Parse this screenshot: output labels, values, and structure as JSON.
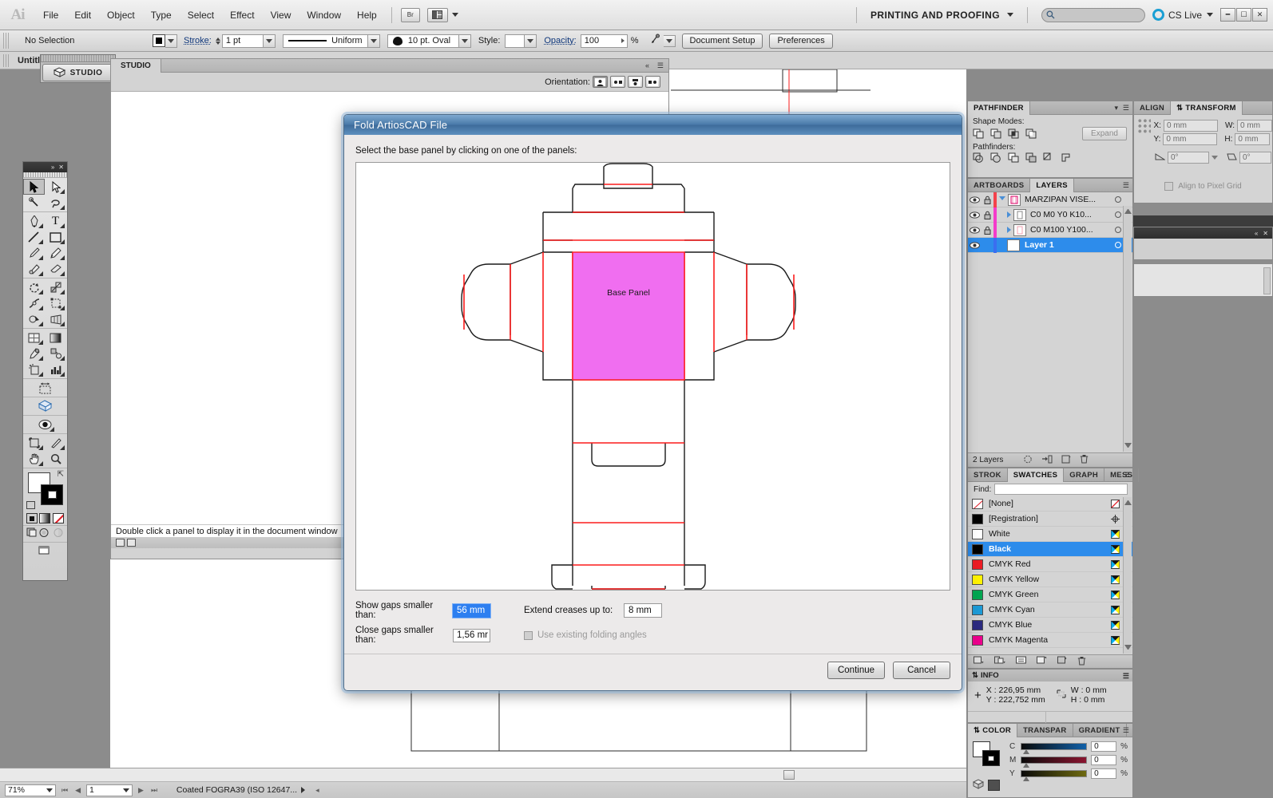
{
  "app": {
    "logo": "Ai",
    "menus": [
      "File",
      "Edit",
      "Object",
      "Type",
      "Select",
      "Effect",
      "View",
      "Window",
      "Help"
    ],
    "bridge_label": "Br",
    "workspace": "PRINTING AND PROOFING",
    "search_placeholder": "",
    "cslive": "CS Live"
  },
  "control_bar": {
    "selection_status": "No Selection",
    "stroke_label": "Stroke:",
    "stroke_weight": "1 pt",
    "profile": "Uniform",
    "brush": "10 pt. Oval",
    "style_label": "Style:",
    "opacity_label": "Opacity:",
    "opacity_value": "100",
    "opacity_unit": "%",
    "document_setup": "Document Setup",
    "preferences": "Preferences"
  },
  "document": {
    "tab_title": "Untitled"
  },
  "studio": {
    "float_button": "STUDIO",
    "tab": "STUDIO",
    "orientation_label": "Orientation:",
    "hint": "Double click a panel to display it in the document window"
  },
  "dialog": {
    "title": "Fold ArtiosCAD File",
    "instruction": "Select the base panel by clicking on one of the panels:",
    "base_panel_label": "Base Panel",
    "fields": {
      "show_gaps_label": "Show gaps smaller than:",
      "show_gaps_value": "56 mm",
      "close_gaps_label": "Close gaps smaller than:",
      "close_gaps_value": "1,56 mr",
      "extend_creases_label": "Extend creases up to:",
      "extend_creases_value": "8 mm",
      "use_existing_label": "Use existing folding angles",
      "use_existing_checked": false
    },
    "buttons": {
      "continue": "Continue",
      "cancel": "Cancel"
    },
    "colors": {
      "base_panel_fill": "#f06ef0",
      "crease_line": "#fc1c1c",
      "cut_line": "#1a1a1a"
    }
  },
  "pathfinder": {
    "tab": "PATHFINDER",
    "shape_modes_label": "Shape Modes:",
    "pathfinders_label": "Pathfinders:",
    "expand_button": "Expand"
  },
  "align_transform": {
    "align_tab": "ALIGN",
    "transform_tab": "TRANSFORM",
    "x_label": "X:",
    "x_value": "0 mm",
    "y_label": "Y:",
    "y_value": "0 mm",
    "w_label": "W:",
    "w_value": "0 mm",
    "h_label": "H:",
    "h_value": "0 mm",
    "angle_value": "0°",
    "shear_value": "0°",
    "align_pixel_grid": "Align to Pixel Grid"
  },
  "layers_panel": {
    "artboards_tab": "ARTBOARDS",
    "layers_tab": "LAYERS",
    "count_label": "2 Layers",
    "rows": [
      {
        "name": "MARZIPAN VISE...",
        "color": "#f4424b",
        "locked": true,
        "indent": 0,
        "selected": false,
        "expanded": true,
        "has_children": true
      },
      {
        "name": "C0 M0 Y0 K10...",
        "color": "#f43ccb",
        "locked": true,
        "indent": 1,
        "selected": false,
        "expanded": false,
        "has_children": true
      },
      {
        "name": "C0 M100 Y100...",
        "color": "#f43ccb",
        "locked": true,
        "indent": 1,
        "selected": false,
        "expanded": false,
        "has_children": true
      },
      {
        "name": "Layer 1",
        "color": "#3a6ef0",
        "locked": false,
        "indent": 0,
        "selected": true,
        "expanded": false,
        "has_children": false
      }
    ]
  },
  "swatches_panel": {
    "tabs": [
      "STROK",
      "SWATCHES",
      "GRAPH",
      "MESS"
    ],
    "active_tab": "SWATCHES",
    "find_label": "Find:",
    "find_value": "",
    "swatches": [
      {
        "name": "[None]",
        "color": "none",
        "mark": "none",
        "selected": false
      },
      {
        "name": "[Registration]",
        "color": "#000000",
        "mark": "registration",
        "selected": false
      },
      {
        "name": "White",
        "color": "#ffffff",
        "mark": "cmyk",
        "selected": false
      },
      {
        "name": "Black",
        "color": "#000000",
        "mark": "cmyk",
        "selected": true
      },
      {
        "name": "CMYK Red",
        "color": "#ec1c24",
        "mark": "cmyk",
        "selected": false
      },
      {
        "name": "CMYK Yellow",
        "color": "#fff200",
        "mark": "cmyk",
        "selected": false
      },
      {
        "name": "CMYK Green",
        "color": "#00a651",
        "mark": "cmyk",
        "selected": false
      },
      {
        "name": "CMYK Cyan",
        "color": "#1c9ad6",
        "mark": "cmyk",
        "selected": false
      },
      {
        "name": "CMYK Blue",
        "color": "#2b2a7f",
        "mark": "cmyk",
        "selected": false
      },
      {
        "name": "CMYK Magenta",
        "color": "#ec008c",
        "mark": "cmyk",
        "selected": false
      }
    ]
  },
  "info_panel": {
    "tab": "INFO",
    "x_label": "X",
    "x_value": ": 226,95 mm",
    "y_label": "Y",
    "y_value": ": 222,752 mm",
    "w_label": "W",
    "w_value": ": 0 mm",
    "h_label": "H",
    "h_value": ": 0 mm"
  },
  "color_panel": {
    "tabs": [
      "COLOR",
      "TRANSPAR",
      "GRADIENT"
    ],
    "active_tab": "COLOR",
    "channels": [
      {
        "label": "C",
        "value": "0",
        "unit": "%"
      },
      {
        "label": "M",
        "value": "0",
        "unit": "%"
      },
      {
        "label": "Y",
        "value": "0",
        "unit": "%"
      }
    ]
  },
  "status_bar": {
    "zoom": "71%",
    "page": "1",
    "profile": "Coated FOGRA39 (ISO 12647..."
  },
  "toolbox": {
    "tools": [
      [
        "selection-tool",
        "direct-selection-tool"
      ],
      [
        "magic-wand-tool",
        "lasso-tool"
      ],
      [
        "pen-tool",
        "type-tool"
      ],
      [
        "line-segment-tool",
        "rectangle-tool"
      ],
      [
        "paintbrush-tool",
        "pencil-tool"
      ],
      [
        "blob-brush-tool",
        "eraser-tool"
      ],
      [
        "rotate-tool",
        "scale-tool"
      ],
      [
        "width-tool",
        "free-transform-tool"
      ],
      [
        "shape-builder-tool",
        "perspective-grid-tool"
      ],
      [
        "mesh-tool",
        "gradient-tool"
      ],
      [
        "eyedropper-tool",
        "blend-tool"
      ],
      [
        "symbol-sprayer-tool",
        "column-graph-tool"
      ],
      [
        "artboard-tool"
      ],
      [
        "3d-cube-tool"
      ],
      [
        "live-paint-tool"
      ],
      [
        "slice-tool",
        "knife-tool"
      ],
      [
        "hand-tool",
        "zoom-tool"
      ]
    ]
  }
}
